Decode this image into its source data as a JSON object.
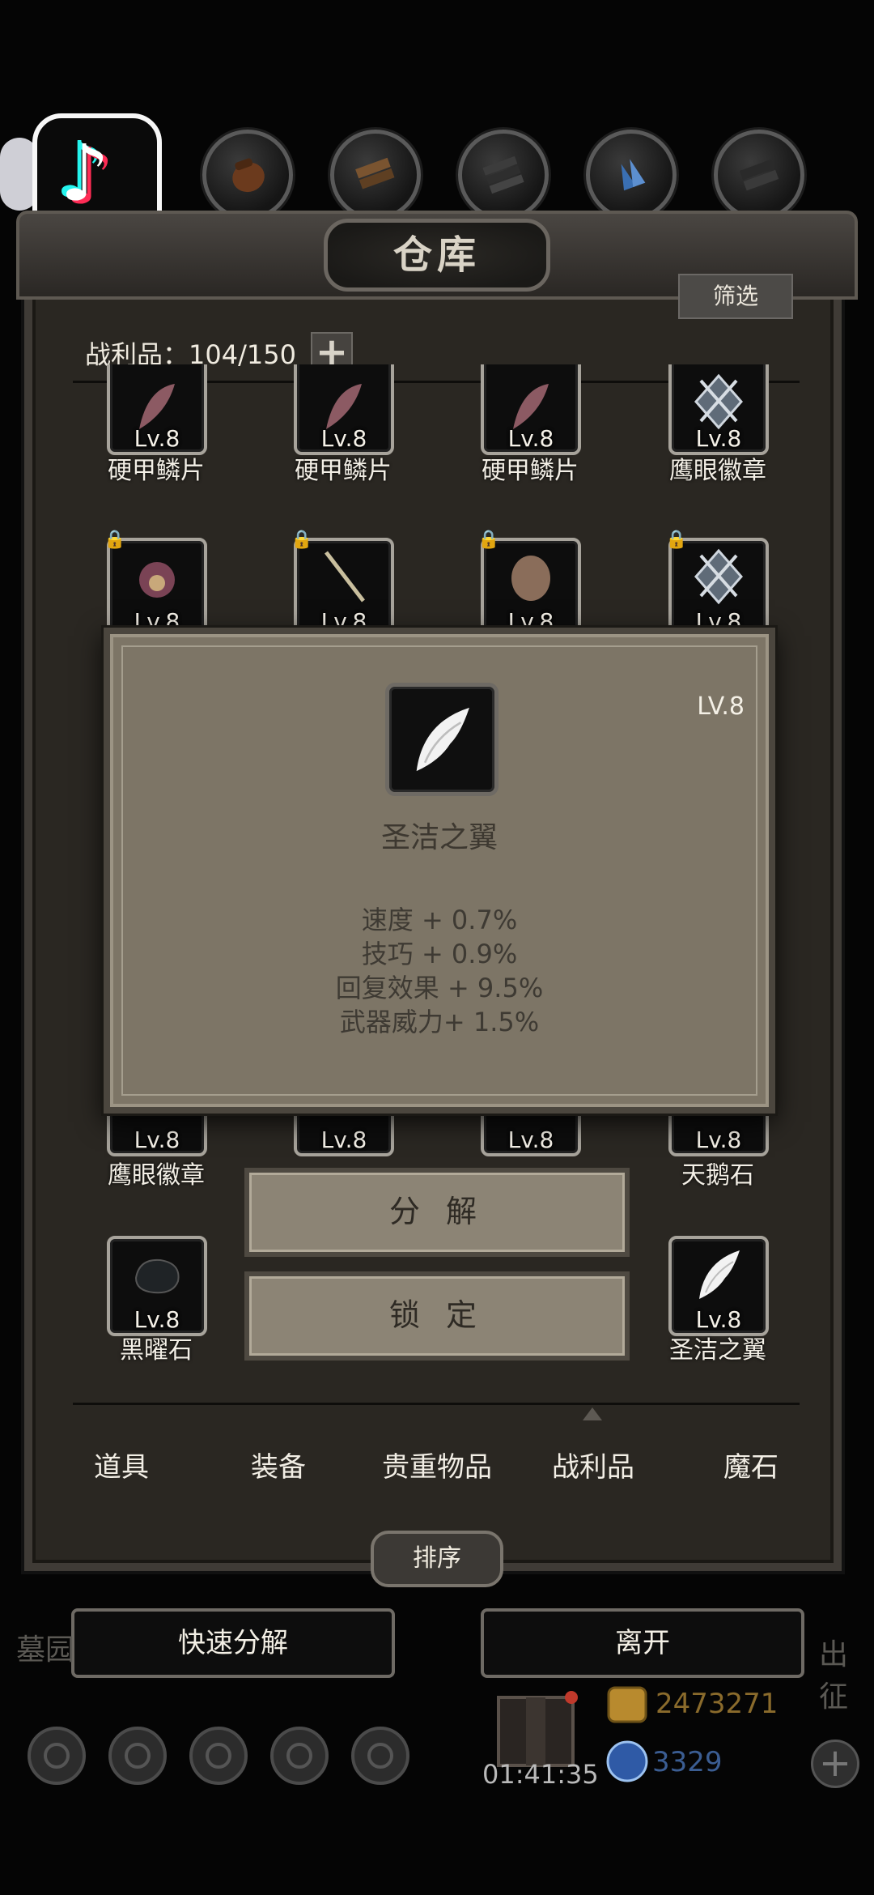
{
  "warehouse": {
    "title": "仓库",
    "filter_label": "筛选",
    "count_label": "战利品：104/150",
    "plus_label": "+"
  },
  "grid": {
    "row1": [
      {
        "level": "Lv.8",
        "name": "硬甲鳞片"
      },
      {
        "level": "Lv.8",
        "name": "硬甲鳞片"
      },
      {
        "level": "Lv.8",
        "name": "硬甲鳞片"
      },
      {
        "level": "Lv.8",
        "name": "鹰眼徽章"
      }
    ],
    "row2": [
      {
        "level": "Lv.8"
      },
      {
        "level": "Lv.8"
      },
      {
        "level": "Lv.8"
      },
      {
        "level": "Lv.8"
      }
    ],
    "row5": [
      {
        "level": "Lv.8",
        "name": "鹰眼徽章"
      },
      {
        "level": "Lv.8"
      },
      {
        "level": "Lv.8"
      },
      {
        "level": "Lv.8",
        "name": "天鹅石"
      }
    ],
    "row6": [
      {
        "level": "Lv.8",
        "name": "黑曜石"
      },
      {
        "level": "Lv.8",
        "name": "圣洁之翼"
      }
    ]
  },
  "popup": {
    "level": "LV.8",
    "name": "圣洁之翼",
    "stats": [
      "速度 + 0.7%",
      "技巧 + 0.9%",
      "回复效果 + 9.5%",
      "武器威力+ 1.5%"
    ]
  },
  "actions": {
    "decompose_label": "分 解",
    "lock_label": "锁 定"
  },
  "tabs": [
    "道具",
    "装备",
    "贵重物品",
    "战利品",
    "魔石"
  ],
  "active_tab": "战利品",
  "sort_label": "排序",
  "bottom": {
    "quick_decompose_label": "快速分解",
    "leave_label": "离开",
    "left_side_text": "墓园",
    "right_side_text": "出征",
    "timer": "01:41:35",
    "gold": "2473271",
    "gems": "3329"
  },
  "colors": {
    "frame": "#2a2722",
    "popup": "#7d7566",
    "gold_text": "#8a6b2c",
    "gem_text": "#3b5d92"
  },
  "icons": [
    "tiktok-icon",
    "pouch-icon",
    "wood-icon",
    "ore-icon",
    "crystal-icon",
    "ingot-icon",
    "scale-icon",
    "badge-icon",
    "wing-icon",
    "obsidian-icon",
    "lock-icon",
    "chest-icon",
    "gold-coin-icon",
    "gem-icon",
    "add-icon"
  ]
}
